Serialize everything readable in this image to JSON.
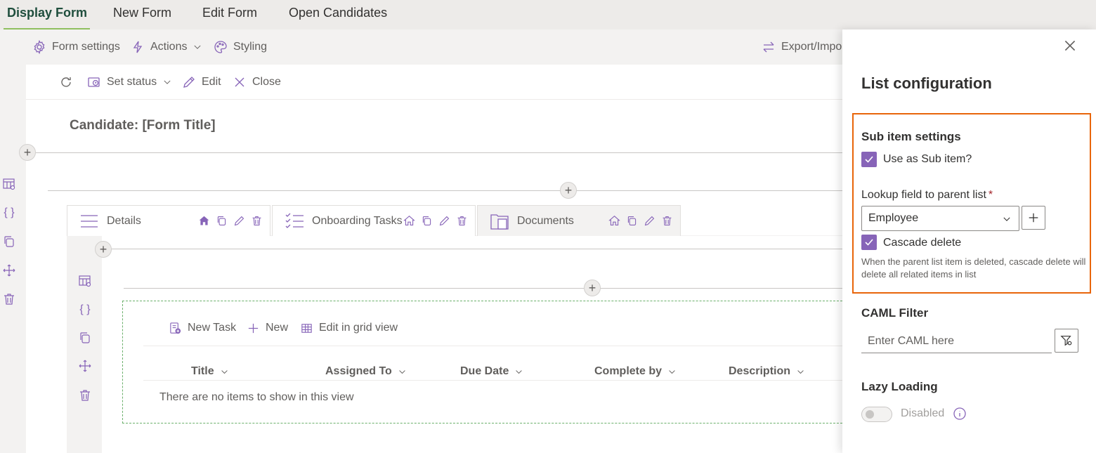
{
  "top_tabs": [
    {
      "label": "Display Form",
      "active": true
    },
    {
      "label": "New Form",
      "active": false
    },
    {
      "label": "Edit Form",
      "active": false
    },
    {
      "label": "Open Candidates",
      "active": false
    }
  ],
  "command_bar": {
    "form_settings": "Form settings",
    "actions": "Actions",
    "styling": "Styling",
    "export_import": "Export/Impo"
  },
  "form_toolbar": {
    "set_status": "Set status",
    "edit": "Edit",
    "close": "Close"
  },
  "form": {
    "title": "Candidate: [Form Title]"
  },
  "tabs": [
    {
      "label": "Details",
      "icon": "menu-icon"
    },
    {
      "label": "Onboarding Tasks",
      "icon": "checklist-icon"
    },
    {
      "label": "Documents",
      "icon": "documents-icon"
    }
  ],
  "list": {
    "commands": {
      "new_task": "New Task",
      "new": "New",
      "edit_grid": "Edit in grid view"
    },
    "columns": [
      "Title",
      "Assigned To",
      "Due Date",
      "Complete by",
      "Description"
    ],
    "empty_message": "There are no items to show in this view"
  },
  "panel": {
    "title": "List configuration",
    "sub_item": {
      "heading": "Sub item settings",
      "use_as_sub_item_label": "Use as Sub item?",
      "use_as_sub_item_checked": true,
      "lookup_label": "Lookup field to parent list",
      "lookup_required_mark": "*",
      "lookup_value": "Employee",
      "cascade_label": "Cascade delete",
      "cascade_checked": true,
      "cascade_help": "When the parent list item is deleted, cascade delete will delete all related items in list"
    },
    "caml": {
      "heading": "CAML Filter",
      "placeholder": "Enter CAML here"
    },
    "lazy": {
      "heading": "Lazy Loading",
      "state_label": "Disabled",
      "enabled": false
    }
  },
  "colors": {
    "accent": "#8764b8",
    "highlight_border": "#e8650a",
    "active_tab_underline": "#8fbf5f"
  }
}
